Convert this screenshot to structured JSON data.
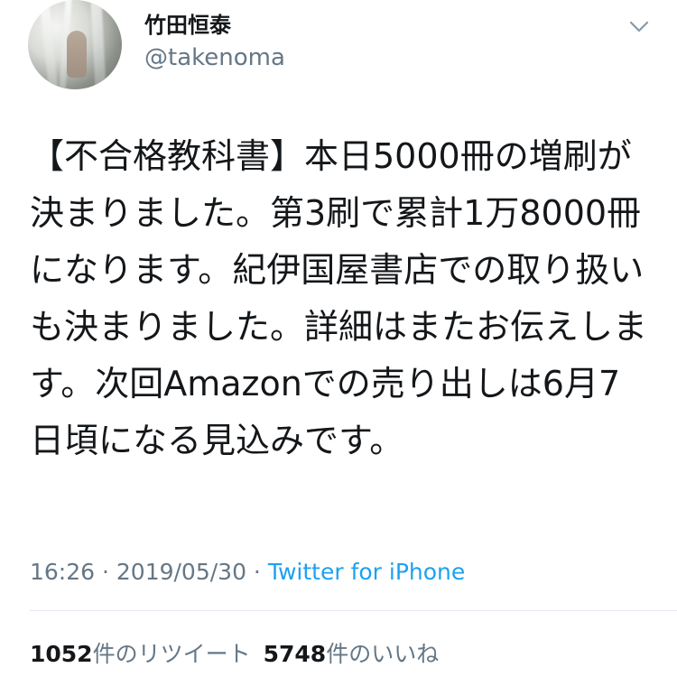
{
  "user": {
    "display_name": "竹田恒泰",
    "handle": "@takenoma"
  },
  "tweet": {
    "text": "【不合格教科書】本日5000冊の増刷が決まりました。第3刷で累計1万8000冊になります。紀伊国屋書店での取り扱いも決まりました。詳細はまたお伝えします。次回Amazonでの売り出しは6月7日頃になる見込みです。",
    "time": "16:26",
    "separator": " · ",
    "date": "2019/05/30",
    "source": "Twitter for iPhone"
  },
  "stats": {
    "retweets_count": "1052",
    "retweets_label": "件のリツイート",
    "likes_count": "5748",
    "likes_label": "件のいいね"
  },
  "icons": {
    "menu": "chevron-down-icon",
    "avatar": "avatar"
  },
  "colors": {
    "text": "#14171a",
    "secondary": "#657786",
    "link": "#1da1f2",
    "divider": "#e1e8ed"
  }
}
